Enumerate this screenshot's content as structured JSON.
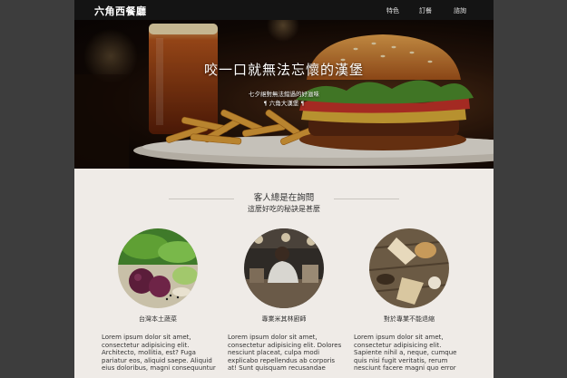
{
  "navbar": {
    "brand": "六角西餐廳",
    "links": [
      "特色",
      "訂餐",
      "諮詢"
    ]
  },
  "hero": {
    "title": "咬一口就無法忘懷的漢堡",
    "subtitle": "七夕絕對無法錯過的好滋味",
    "tagline": "¶ 六角大漢堡 ¶"
  },
  "section": {
    "title": "客人總是在詢問",
    "subtitle": "這麼好吃的秘訣是甚麼"
  },
  "features": [
    {
      "label": "台灣本土蔬菜",
      "lines": [
        "Lorem ipsum dolor sit amet,",
        "consectetur adipisicing elit.",
        "Architecto, mollitia, est? Fuga",
        "pariatur eos, aliquid saepe. Aliquid",
        "eius doloribus, magni consequuntur"
      ]
    },
    {
      "label": "專業米其林廚師",
      "lines": [
        "Lorem ipsum dolor sit amet,",
        "consectetur adipisicing elit. Dolores",
        "nesciunt placeat, culpa modi",
        "explicabo repellendus ab corporis",
        "at! Sunt quisquam recusandae"
      ]
    },
    {
      "label": "對於專業不能退縮",
      "lines": [
        "Lorem ipsum dolor sit amet,",
        "consectetur adipisicing elit.",
        "Sapiente nihil a, neque, cumque",
        "quis nisi fugit veritatis, rerum",
        "nesciunt facere magni quo error"
      ]
    }
  ],
  "colors": {
    "navbar_bg": "#141414",
    "page_bg": "#efebe7",
    "outer_bg": "#3d3d3d",
    "text_dark": "#333333"
  }
}
